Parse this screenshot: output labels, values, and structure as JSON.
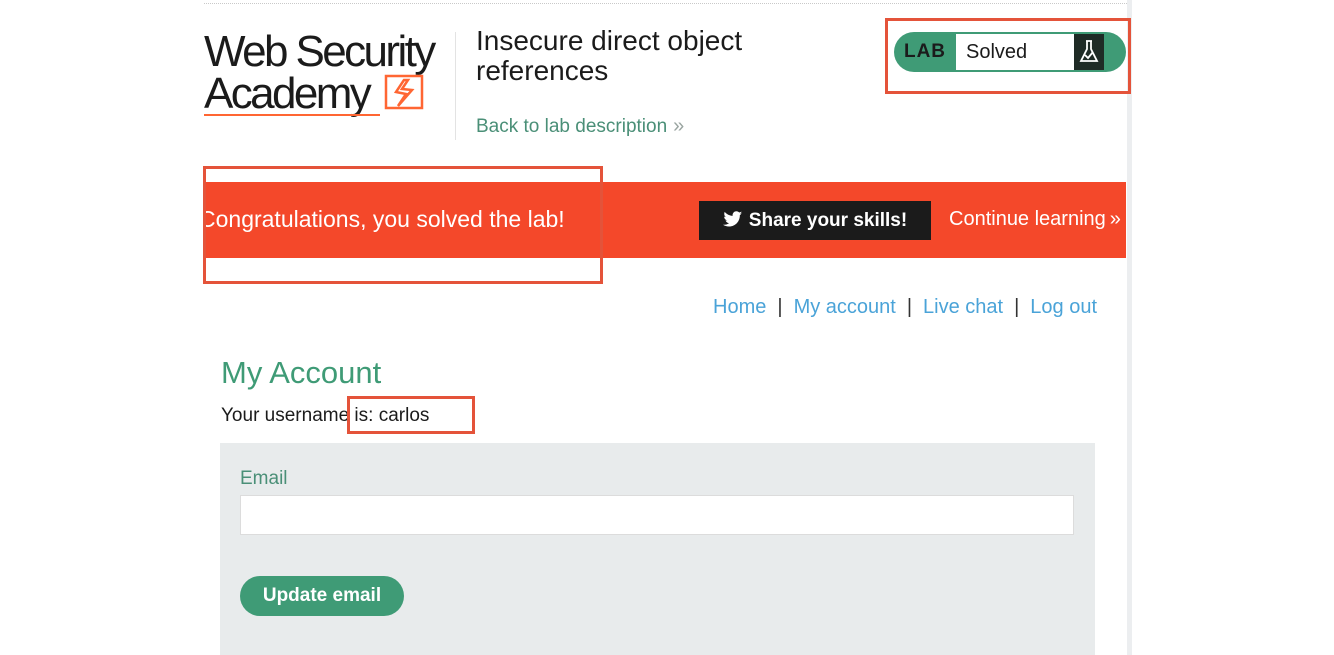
{
  "header": {
    "logo_line1": "Web Security",
    "logo_line2": "Academy",
    "lab_title": "Insecure direct object references",
    "back_link": "Back to lab description"
  },
  "status": {
    "badge": "LAB",
    "text": "Solved",
    "icon": "flask-icon"
  },
  "banner": {
    "message": "Congratulations, you solved the lab!",
    "share_label": "Share your skills!",
    "share_icon": "twitter-icon",
    "continue_label": "Continue learning"
  },
  "nav": {
    "items": [
      "Home",
      "My account",
      "Live chat",
      "Log out"
    ],
    "separator": "|"
  },
  "account": {
    "title": "My Account",
    "username_line": "Your username is: carlos"
  },
  "form": {
    "email_label": "Email",
    "email_value": "",
    "submit_label": "Update email"
  },
  "colors": {
    "accent_green": "#3f9b76",
    "banner_orange": "#f4482a",
    "link_blue": "#4aa3d8",
    "highlight_red": "#e4533a"
  }
}
